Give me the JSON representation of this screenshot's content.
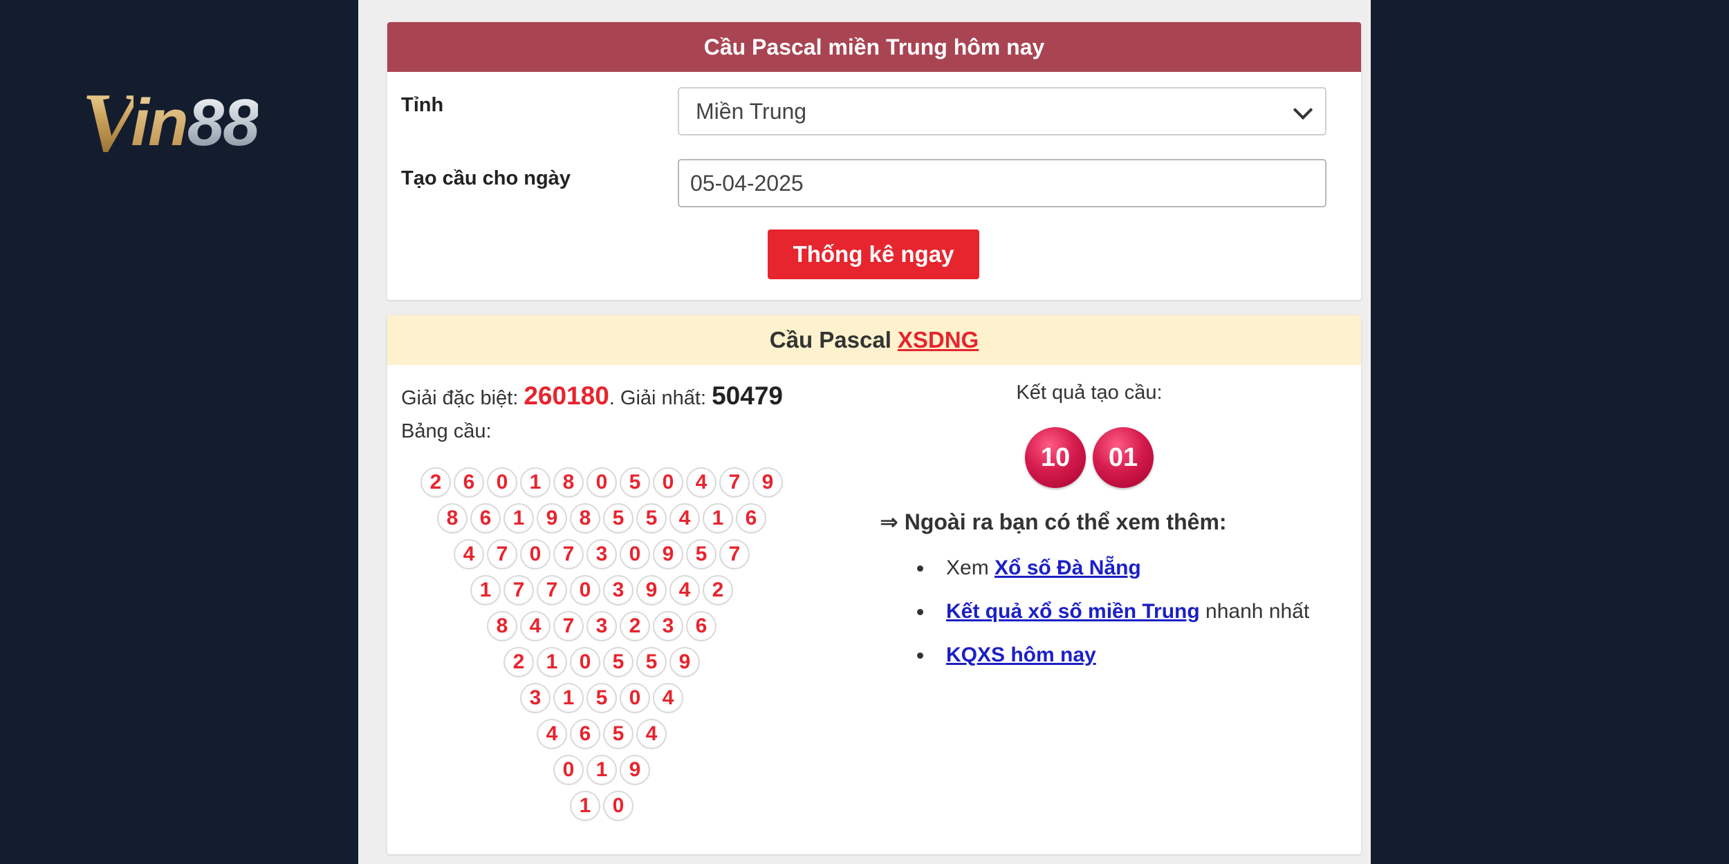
{
  "logo": {
    "text_v": "V",
    "text_in": "in",
    "text_num": "88"
  },
  "form": {
    "title": "Cầu Pascal miền Trung hôm nay",
    "province_label": "Tỉnh",
    "province_value": "Miền Trung",
    "date_label": "Tạo cầu cho ngày",
    "date_value": "05-04-2025",
    "submit_label": "Thống kê ngay"
  },
  "result": {
    "title_prefix": "Cầu Pascal",
    "title_link": "XSDNG",
    "special_prize_label": "Giải đặc biệt: ",
    "special_prize_value": "260180",
    "first_prize_sep": ". Giải nhất: ",
    "first_prize_value": "50479",
    "board_label": "Bảng cầu:",
    "result_label": "Kết quả tạo cầu:",
    "result_numbers": [
      "10",
      "01"
    ],
    "triangle": [
      [
        "2",
        "6",
        "0",
        "1",
        "8",
        "0",
        "5",
        "0",
        "4",
        "7",
        "9"
      ],
      [
        "8",
        "6",
        "1",
        "9",
        "8",
        "5",
        "5",
        "4",
        "1",
        "6"
      ],
      [
        "4",
        "7",
        "0",
        "7",
        "3",
        "0",
        "9",
        "5",
        "7"
      ],
      [
        "1",
        "7",
        "7",
        "0",
        "3",
        "9",
        "4",
        "2"
      ],
      [
        "8",
        "4",
        "7",
        "3",
        "2",
        "3",
        "6"
      ],
      [
        "2",
        "1",
        "0",
        "5",
        "5",
        "9"
      ],
      [
        "3",
        "1",
        "5",
        "0",
        "4"
      ],
      [
        "4",
        "6",
        "5",
        "4"
      ],
      [
        "0",
        "1",
        "9"
      ],
      [
        "1",
        "0"
      ]
    ],
    "more_heading": "⇒ Ngoài ra bạn có thể xem thêm:",
    "links": [
      {
        "prefix": "Xem ",
        "link": "Xổ số Đà Nẵng",
        "suffix": ""
      },
      {
        "prefix": "",
        "link": "Kết quả xổ số miền Trung",
        "suffix": " nhanh nhất"
      },
      {
        "prefix": "",
        "link": "KQXS hôm nay",
        "suffix": ""
      }
    ]
  },
  "colors": {
    "background": "#141d2e",
    "header_red": "#a94453",
    "accent_red": "#e6252e",
    "header_yellow": "#fdf2cd",
    "link_blue": "#1c20c4"
  }
}
